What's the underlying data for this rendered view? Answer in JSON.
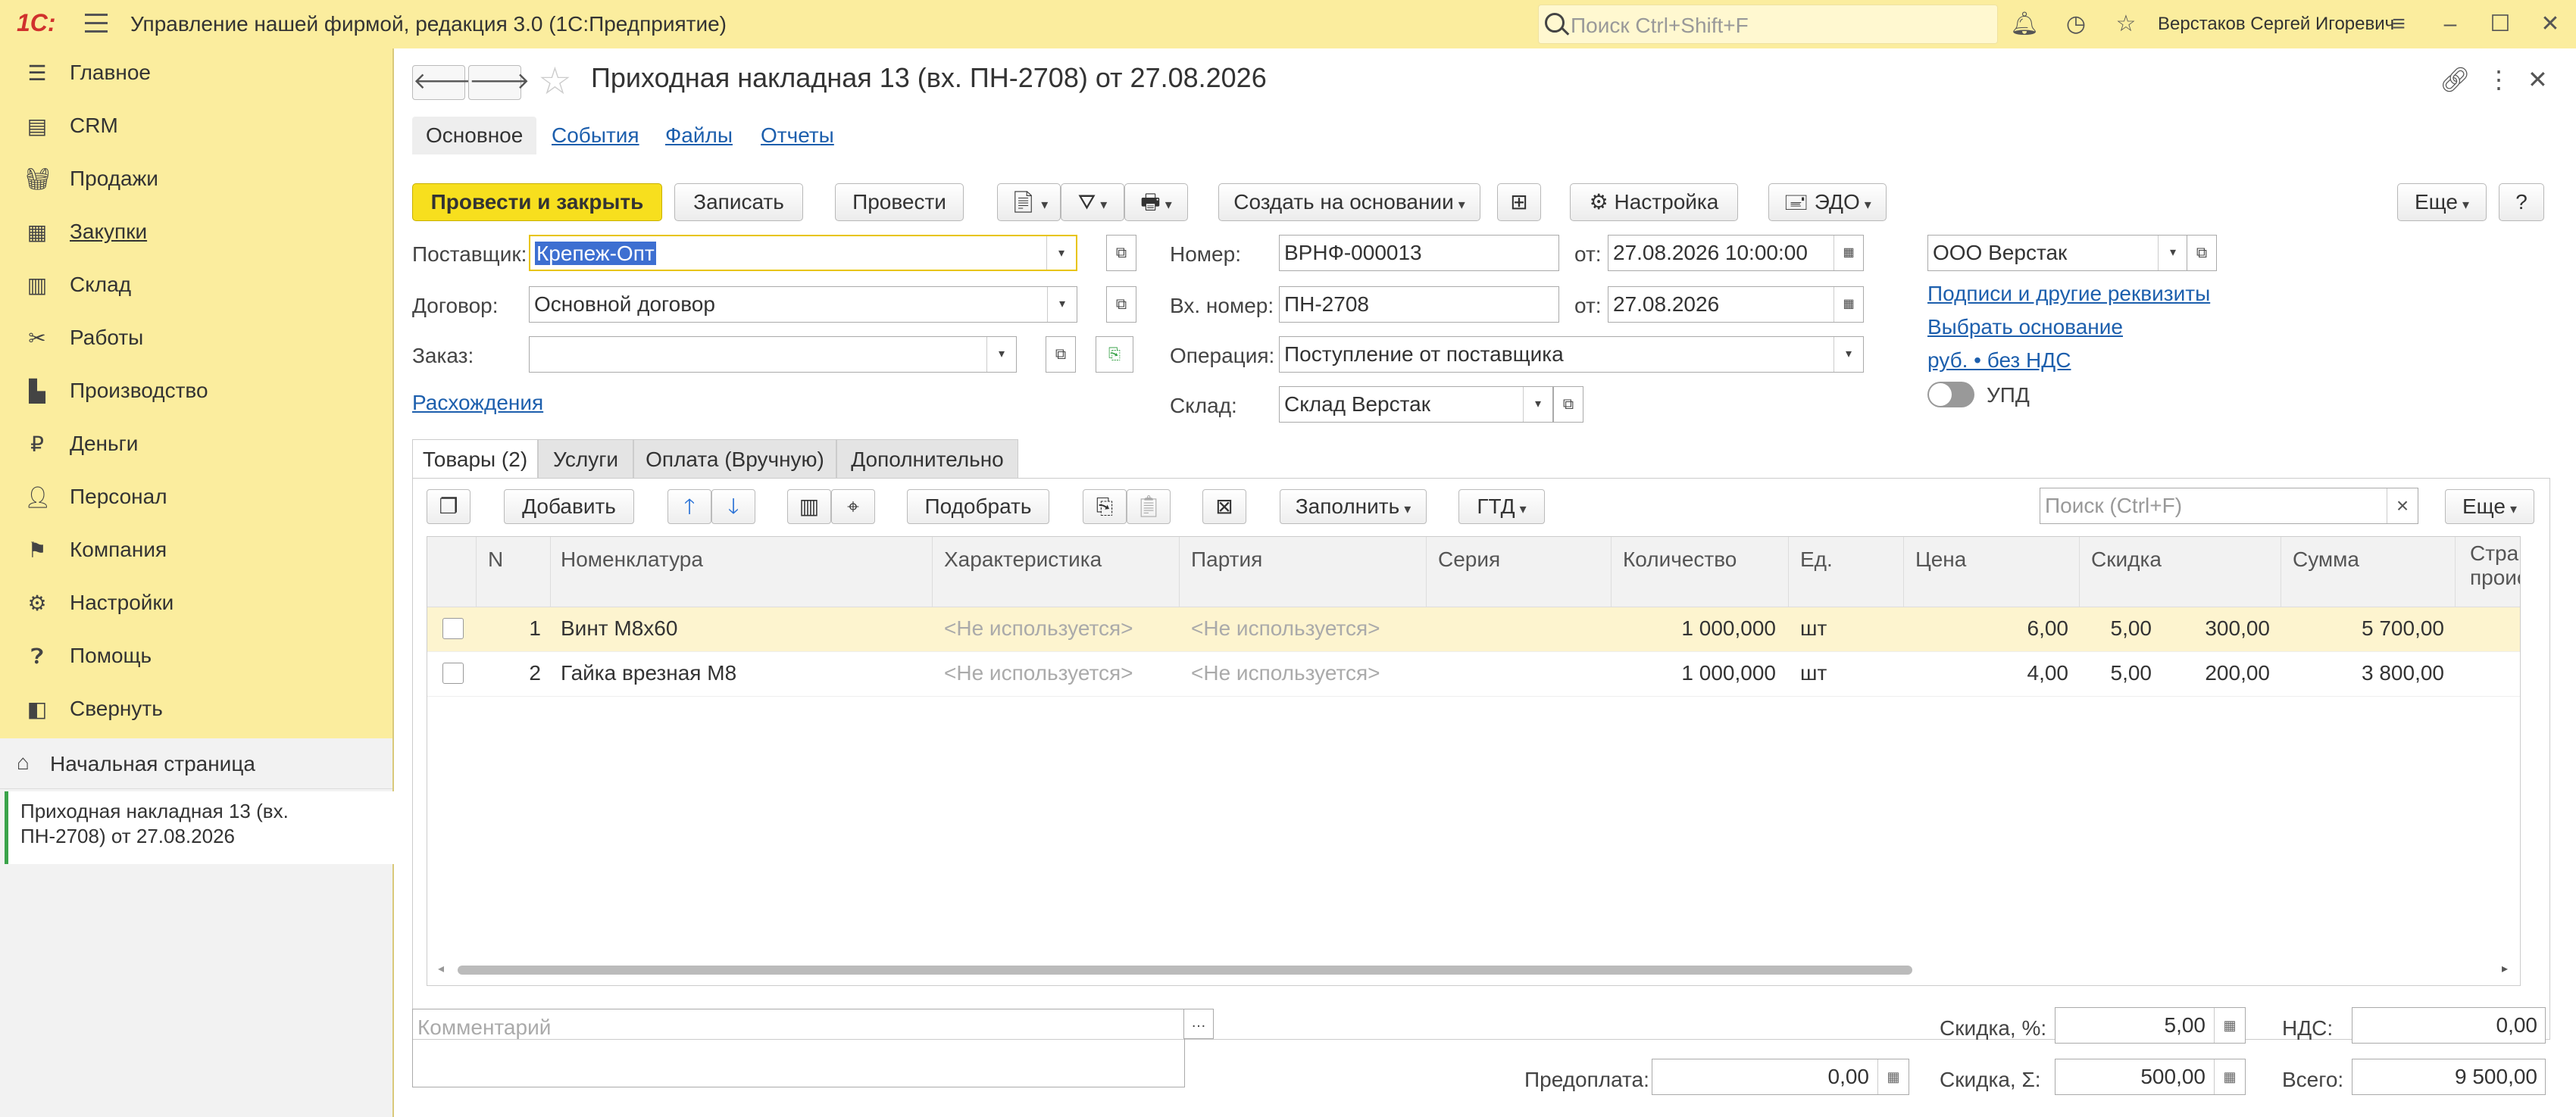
{
  "topbar": {
    "logo": "1С:",
    "title": "Управление нашей фирмой, редакция 3.0  (1С:Предприятие)",
    "search_placeholder": "Поиск Ctrl+Shift+F",
    "user": "Верстаков Сергей Игоревич"
  },
  "sidebar": {
    "items": [
      {
        "label": "Главное",
        "icon": "menu-lines-icon"
      },
      {
        "label": "CRM",
        "icon": "crm-icon"
      },
      {
        "label": "Продажи",
        "icon": "basket-icon"
      },
      {
        "label": "Закупки",
        "icon": "purchases-icon"
      },
      {
        "label": "Склад",
        "icon": "warehouse-icon"
      },
      {
        "label": "Работы",
        "icon": "tools-icon"
      },
      {
        "label": "Производство",
        "icon": "factory-icon"
      },
      {
        "label": "Деньги",
        "icon": "money-icon"
      },
      {
        "label": "Персонал",
        "icon": "person-icon"
      },
      {
        "label": "Компания",
        "icon": "flag-icon"
      },
      {
        "label": "Настройки",
        "icon": "gear-icon"
      },
      {
        "label": "Помощь",
        "icon": "help-icon"
      },
      {
        "label": "Свернуть",
        "icon": "collapse-icon"
      }
    ],
    "home": "Начальная страница",
    "open_doc": "Приходная накладная 13 (вх. ПН-2708) от 27.08.2026"
  },
  "doc": {
    "title": "Приходная накладная 13 (вх. ПН-2708) от 27.08.2026",
    "tabs": [
      "Основное",
      "События",
      "Файлы",
      "Отчеты"
    ]
  },
  "toolbar": {
    "post_close": "Провести и закрыть",
    "save": "Записать",
    "post": "Провести",
    "create_based": "Создать на основании",
    "settings": "Настройка",
    "edo": "ЭДО",
    "more": "Еще",
    "help": "?"
  },
  "form": {
    "supplier_label": "Поставщик:",
    "supplier": "Крепеж-Опт",
    "contract_label": "Договор:",
    "contract": "Основной договор",
    "order_label": "Заказ:",
    "order": "",
    "discrepancies": "Расхождения",
    "number_label": "Номер:",
    "number": "ВРНФ-000013",
    "from_label": "от:",
    "date": "27.08.2026 10:00:00",
    "in_number_label": "Вх. номер:",
    "in_number": "ПН-2708",
    "in_date": "27.08.2026",
    "operation_label": "Операция:",
    "operation": "Поступление от поставщика",
    "warehouse_label": "Склад:",
    "warehouse": "Склад Верстак",
    "company": "ООО Верстак",
    "signatures": "Подписи и другие реквизиты",
    "choose_basis": "Выбрать основание",
    "currency_vat": "руб. • без НДС",
    "upd": "УПД"
  },
  "inner_tabs": [
    "Товары (2)",
    "Услуги",
    "Оплата (Вручную)",
    "Дополнительно"
  ],
  "table_toolbar": {
    "add": "Добавить",
    "pick": "Подобрать",
    "fill": "Заполнить",
    "gtd": "ГТД",
    "search_placeholder": "Поиск (Ctrl+F)",
    "more": "Еще"
  },
  "grid": {
    "headers": [
      "N",
      "Номенклатура",
      "Характеристика",
      "Партия",
      "Серия",
      "Количество",
      "Ед.",
      "Цена",
      "Скидка",
      "Сумма",
      "Стра\nпроис"
    ],
    "rows": [
      {
        "n": "1",
        "name": "Винт М8х60",
        "char": "<Не используется>",
        "batch": "<Не используется>",
        "series": "",
        "qty": "1 000,000",
        "unit": "шт",
        "price": "6,00",
        "disc_pct": "5,00",
        "disc_sum": "300,00",
        "sum": "5 700,00"
      },
      {
        "n": "2",
        "name": "Гайка врезная М8",
        "char": "<Не используется>",
        "batch": "<Не используется>",
        "series": "",
        "qty": "1 000,000",
        "unit": "шт",
        "price": "4,00",
        "disc_pct": "5,00",
        "disc_sum": "200,00",
        "sum": "3 800,00"
      }
    ]
  },
  "footer": {
    "comment_placeholder": "Комментарий",
    "prepay_label": "Предоплата:",
    "prepay": "0,00",
    "discount_pct_label": "Скидка, %:",
    "discount_pct": "5,00",
    "discount_sum_label": "Скидка, Σ:",
    "discount_sum": "500,00",
    "vat_label": "НДС:",
    "vat": "0,00",
    "total_label": "Всего:",
    "total": "9 500,00"
  },
  "colors": {
    "accent": "#fbed9e",
    "primary_button": "#f7df1e",
    "link": "#1d5fad",
    "selection": "#3d6fd1"
  }
}
